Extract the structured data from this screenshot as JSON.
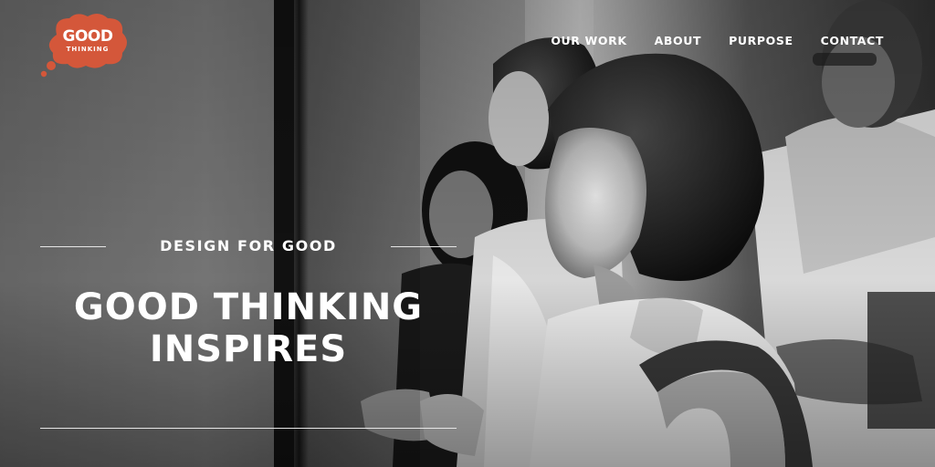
{
  "brand": {
    "logo_word": "GOOD",
    "logo_sub": "THINKING",
    "logo_color": "#d4573a"
  },
  "nav": {
    "items": [
      {
        "label": "OUR WORK"
      },
      {
        "label": "ABOUT"
      },
      {
        "label": "PURPOSE"
      },
      {
        "label": "CONTACT"
      }
    ]
  },
  "hero": {
    "kicker": "DESIGN FOR GOOD",
    "headline": "GOOD THINKING\nINSPIRES",
    "photo": "black-and-white photo of people listening attentively"
  }
}
